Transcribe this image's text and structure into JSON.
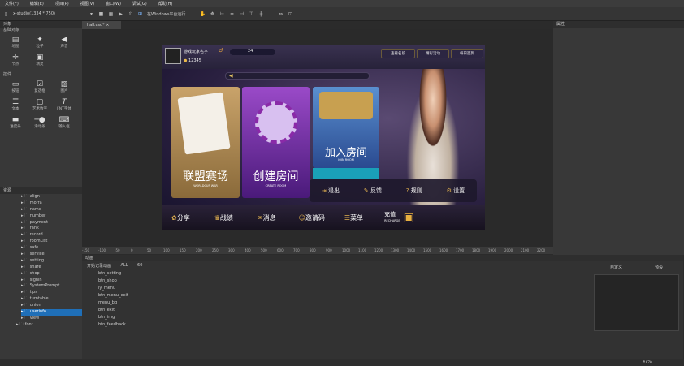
{
  "menu": [
    "文件(F)",
    "编辑(E)",
    "项目(P)",
    "视图(V)",
    "窗口(W)",
    "调试(G)",
    "帮助(H)"
  ],
  "toolbar": {
    "resolution": "x-studio(1334 * 750)",
    "run_target": "在Windows平台运行"
  },
  "left_panel": {
    "title": "对象",
    "section_basic": "基础对象",
    "basic_items": [
      {
        "icon": "map-icon",
        "label": "地图"
      },
      {
        "icon": "particle-icon",
        "label": "粒子"
      },
      {
        "icon": "sound-icon",
        "label": "声音"
      },
      {
        "icon": "node-icon",
        "label": "节点"
      },
      {
        "icon": "sprite-icon",
        "label": "精灵"
      }
    ],
    "section_controls": "控件",
    "control_items": [
      {
        "icon": "button-icon",
        "label": "按钮"
      },
      {
        "icon": "checkbox-icon",
        "label": "复选框"
      },
      {
        "icon": "image-icon",
        "label": "图片"
      },
      {
        "icon": "text-icon",
        "label": "文本"
      },
      {
        "icon": "art-number-icon",
        "label": "艺术数字"
      },
      {
        "icon": "fnt-icon",
        "label": "FNT字体"
      },
      {
        "icon": "loading-bar-icon",
        "label": "进度条"
      },
      {
        "icon": "slider-icon",
        "label": "滑动条"
      },
      {
        "icon": "input-icon",
        "label": "输入框"
      }
    ]
  },
  "resources": {
    "title": "资源",
    "items": [
      "align",
      "morra",
      "name",
      "number",
      "payment",
      "rank",
      "record",
      "roomList",
      "safe",
      "service",
      "setting",
      "share",
      "shop",
      "signin",
      "SystemPrompt",
      "tips",
      "turntable",
      "union",
      "userinfo",
      "view",
      "font"
    ],
    "selected": "userinfo"
  },
  "editor_tab": "hall.csd*",
  "game": {
    "player_name": "游戏玩家名字",
    "gender": "♂",
    "level": "24",
    "coins": "12345",
    "top_buttons": [
      "查看名段",
      "精彩活动",
      "每日签到"
    ],
    "cards": [
      {
        "title": "联盟赛场",
        "sub": "WORLDCUP WAR"
      },
      {
        "title": "创建房间",
        "sub": "CREATE ROOM"
      },
      {
        "title": "加入房间",
        "sub": "JOIN ROOM"
      }
    ],
    "side_menu": [
      "退出",
      "反馈",
      "规则",
      "设置"
    ],
    "bottom": [
      "分享",
      "战绩",
      "消息",
      "邀请码",
      "菜单"
    ],
    "recharge": "充值",
    "recharge_sub": "RECHARGE"
  },
  "ruler_labels": [
    "-150",
    "-100",
    "-50",
    "0",
    "50",
    "100",
    "150",
    "200",
    "250",
    "300",
    "400",
    "500",
    "600",
    "700",
    "800",
    "900",
    "1000",
    "1100",
    "1200",
    "1300",
    "1400",
    "1500",
    "1600",
    "1700",
    "1800",
    "1900",
    "2000",
    "2100",
    "2200"
  ],
  "timeline": {
    "title": "动画",
    "start_label": "开始记录动画",
    "filter": "--ALL--",
    "fps": "60",
    "rows": [
      "btn_setting",
      "btn_shop",
      "ly_menu",
      "btn_menu_exit",
      "menu_bg",
      "btn_exit",
      "btn_img",
      "btn_feedback"
    ]
  },
  "right_panel": {
    "title": "属性",
    "col1": "自定义",
    "col2": "预设"
  },
  "status": {
    "zoom": "47%"
  }
}
